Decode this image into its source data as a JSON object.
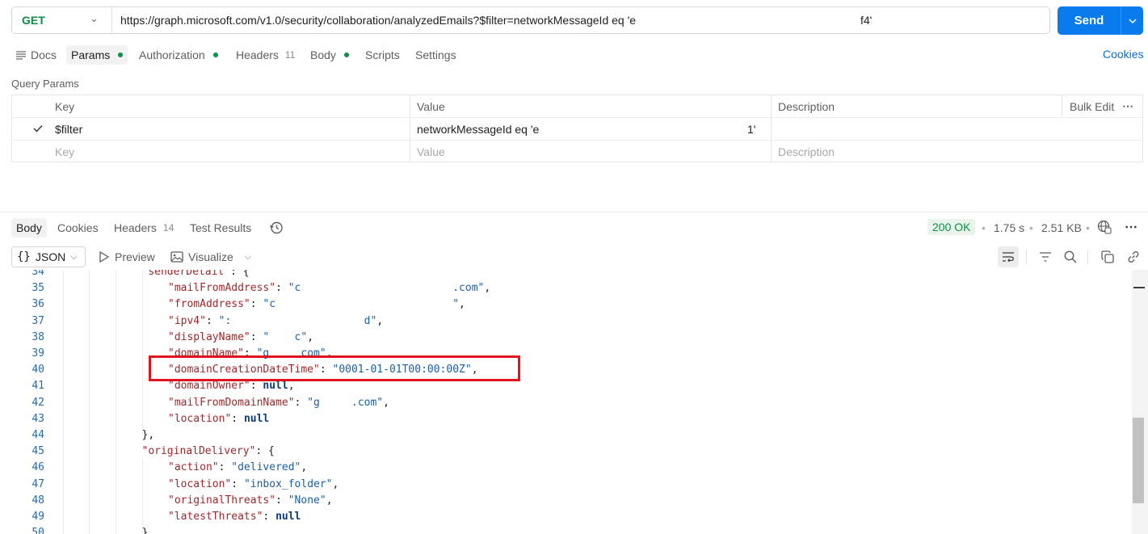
{
  "request": {
    "method": "GET",
    "url": "https://graph.microsoft.com/v1.0/security/collaboration/analyzedEmails?$filter=networkMessageId eq 'e",
    "url_tail": "f4'",
    "send_label": "Send"
  },
  "tabs": [
    {
      "label": "Docs"
    },
    {
      "label": "Params"
    },
    {
      "label": "Authorization"
    },
    {
      "label": "Headers",
      "count": "11"
    },
    {
      "label": "Body"
    },
    {
      "label": "Scripts"
    },
    {
      "label": "Settings"
    }
  ],
  "cookies_link": "Cookies",
  "query_params": {
    "title": "Query Params",
    "headers": {
      "key": "Key",
      "value": "Value",
      "description": "Description",
      "bulk_edit": "Bulk Edit"
    },
    "rows": [
      {
        "key": "$filter",
        "value": "networkMessageId eq 'e",
        "value_tail": "1'",
        "description": ""
      }
    ],
    "placeholder": {
      "key": "Key",
      "value": "Value",
      "description": "Description"
    }
  },
  "response": {
    "tabs": [
      {
        "label": "Body"
      },
      {
        "label": "Cookies"
      },
      {
        "label": "Headers",
        "count": "14"
      },
      {
        "label": "Test Results"
      }
    ],
    "status": "200 OK",
    "time": "1.75 s",
    "size": "2.51 KB",
    "format": "JSON",
    "preview": "Preview",
    "visualize": "Visualize"
  },
  "code_lines": [
    {
      "n": "34",
      "indent": 5,
      "tokens": [
        [
          "k",
          "\"senderDetail\""
        ],
        [
          "p",
          ": {"
        ]
      ]
    },
    {
      "n": "35",
      "indent": 6,
      "tokens": [
        [
          "k",
          "\"mailFromAddress\""
        ],
        [
          "p",
          ": "
        ],
        [
          "s",
          "\"c"
        ],
        [
          "s",
          "                        .com\""
        ],
        [
          "p",
          ","
        ]
      ]
    },
    {
      "n": "36",
      "indent": 6,
      "tokens": [
        [
          "k",
          "\"fromAddress\""
        ],
        [
          "p",
          ": "
        ],
        [
          "s",
          "\"c"
        ],
        [
          "s",
          "                            \""
        ],
        [
          "p",
          ","
        ]
      ]
    },
    {
      "n": "37",
      "indent": 6,
      "tokens": [
        [
          "k",
          "\"ipv4\""
        ],
        [
          "p",
          ": "
        ],
        [
          "s",
          "\":"
        ],
        [
          "s",
          "                     d\""
        ],
        [
          "p",
          ","
        ]
      ]
    },
    {
      "n": "38",
      "indent": 6,
      "tokens": [
        [
          "k",
          "\"displayName\""
        ],
        [
          "p",
          ": "
        ],
        [
          "s",
          "\"    c\""
        ],
        [
          "p",
          ","
        ]
      ]
    },
    {
      "n": "39",
      "indent": 6,
      "tokens": [
        [
          "k",
          "\"domainName\""
        ],
        [
          "p",
          ": "
        ],
        [
          "s",
          "\"g     com\""
        ],
        [
          "p",
          ","
        ]
      ]
    },
    {
      "n": "40",
      "indent": 6,
      "tokens": [
        [
          "k",
          "\"domainCreationDateTime\""
        ],
        [
          "p",
          ": "
        ],
        [
          "s",
          "\"0001-01-01T00:00:00Z\""
        ],
        [
          "p",
          ","
        ]
      ]
    },
    {
      "n": "41",
      "indent": 6,
      "tokens": [
        [
          "k",
          "\"domainOwner\""
        ],
        [
          "p",
          ": "
        ],
        [
          "kw",
          "null"
        ],
        [
          "p",
          ","
        ]
      ]
    },
    {
      "n": "42",
      "indent": 6,
      "tokens": [
        [
          "k",
          "\"mailFromDomainName\""
        ],
        [
          "p",
          ": "
        ],
        [
          "s",
          "\"g     .com\""
        ],
        [
          "p",
          ","
        ]
      ]
    },
    {
      "n": "43",
      "indent": 6,
      "tokens": [
        [
          "k",
          "\"location\""
        ],
        [
          "p",
          ": "
        ],
        [
          "kw",
          "null"
        ]
      ]
    },
    {
      "n": "44",
      "indent": 5,
      "tokens": [
        [
          "p",
          "},"
        ]
      ]
    },
    {
      "n": "45",
      "indent": 5,
      "tokens": [
        [
          "k",
          "\"originalDelivery\""
        ],
        [
          "p",
          ": {"
        ]
      ]
    },
    {
      "n": "46",
      "indent": 6,
      "tokens": [
        [
          "k",
          "\"action\""
        ],
        [
          "p",
          ": "
        ],
        [
          "s",
          "\"delivered\""
        ],
        [
          "p",
          ","
        ]
      ]
    },
    {
      "n": "47",
      "indent": 6,
      "tokens": [
        [
          "k",
          "\"location\""
        ],
        [
          "p",
          ": "
        ],
        [
          "s",
          "\"inbox_folder\""
        ],
        [
          "p",
          ","
        ]
      ]
    },
    {
      "n": "48",
      "indent": 6,
      "tokens": [
        [
          "k",
          "\"originalThreats\""
        ],
        [
          "p",
          ": "
        ],
        [
          "s",
          "\"None\""
        ],
        [
          "p",
          ","
        ]
      ]
    },
    {
      "n": "49",
      "indent": 6,
      "tokens": [
        [
          "k",
          "\"latestThreats\""
        ],
        [
          "p",
          ": "
        ],
        [
          "kw",
          "null"
        ]
      ]
    },
    {
      "n": "50",
      "indent": 5,
      "tokens": [
        [
          "p",
          "},"
        ]
      ]
    }
  ],
  "colors": {
    "accent": "#097bed",
    "get_method": "#0b8f42",
    "highlight_border": "#e0141d"
  }
}
